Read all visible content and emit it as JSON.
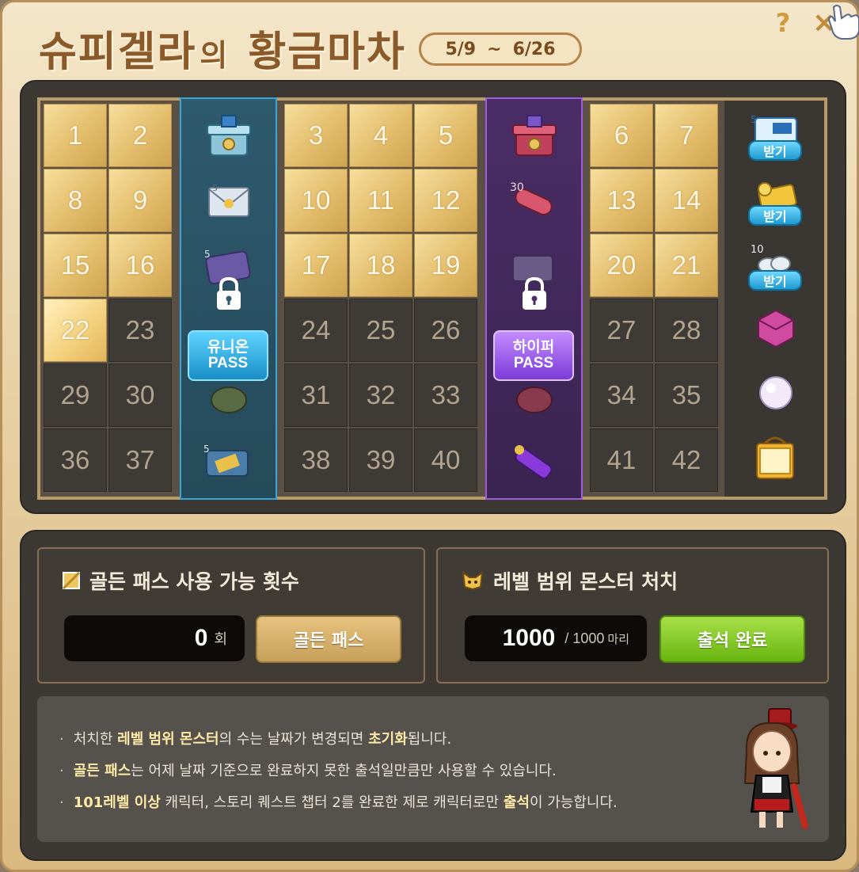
{
  "header": {
    "title_main": "슈피겔라",
    "title_particle": "의",
    "title_sub": "황금마차",
    "date_start": "5/9",
    "date_sep": "~",
    "date_end": "6/26",
    "help": "?",
    "close": "×"
  },
  "calendar": {
    "days_left": [
      {
        "n": "1",
        "s": "gold"
      },
      {
        "n": "2",
        "s": "gold"
      },
      {
        "n": "8",
        "s": "gold"
      },
      {
        "n": "9",
        "s": "gold"
      },
      {
        "n": "15",
        "s": "gold"
      },
      {
        "n": "16",
        "s": "gold"
      },
      {
        "n": "22",
        "s": "today"
      },
      {
        "n": "23",
        "s": "dark"
      },
      {
        "n": "29",
        "s": "dark"
      },
      {
        "n": "30",
        "s": "dark"
      },
      {
        "n": "36",
        "s": "dark"
      },
      {
        "n": "37",
        "s": "dark"
      }
    ],
    "days_mid": [
      {
        "n": "3",
        "s": "gold"
      },
      {
        "n": "4",
        "s": "gold"
      },
      {
        "n": "5",
        "s": "gold"
      },
      {
        "n": "10",
        "s": "gold"
      },
      {
        "n": "11",
        "s": "gold"
      },
      {
        "n": "12",
        "s": "gold"
      },
      {
        "n": "17",
        "s": "gold"
      },
      {
        "n": "18",
        "s": "gold"
      },
      {
        "n": "19",
        "s": "gold"
      },
      {
        "n": "24",
        "s": "dark"
      },
      {
        "n": "25",
        "s": "dark"
      },
      {
        "n": "26",
        "s": "dark"
      },
      {
        "n": "31",
        "s": "dark"
      },
      {
        "n": "32",
        "s": "dark"
      },
      {
        "n": "33",
        "s": "dark"
      },
      {
        "n": "38",
        "s": "dark"
      },
      {
        "n": "39",
        "s": "dark"
      },
      {
        "n": "40",
        "s": "dark"
      }
    ],
    "days_right": [
      {
        "n": "6",
        "s": "gold"
      },
      {
        "n": "7",
        "s": "gold"
      },
      {
        "n": "13",
        "s": "gold"
      },
      {
        "n": "14",
        "s": "gold"
      },
      {
        "n": "20",
        "s": "gold"
      },
      {
        "n": "21",
        "s": "gold"
      },
      {
        "n": "27",
        "s": "dark"
      },
      {
        "n": "28",
        "s": "dark"
      },
      {
        "n": "34",
        "s": "dark"
      },
      {
        "n": "35",
        "s": "dark"
      },
      {
        "n": "41",
        "s": "dark"
      },
      {
        "n": "42",
        "s": "dark"
      }
    ],
    "union_pass": {
      "line1": "유니온",
      "line2": "PASS"
    },
    "hyper_pass": {
      "line1": "하이퍼",
      "line2": "PASS"
    },
    "receive_label": "받기"
  },
  "golden_pass": {
    "title": "골든 패스 사용 가능 횟수",
    "count": "0",
    "unit": "회",
    "button": "골든 패스"
  },
  "monster": {
    "title": "레벨 범위 몬스터 처치",
    "current": "1000",
    "total": "/ 1000",
    "unit": "마리",
    "button": "출석 완료"
  },
  "notes": {
    "n1_a": "처치한 ",
    "n1_b": "레벨 범위 몬스터",
    "n1_c": "의 수는 날짜가 변경되면 ",
    "n1_d": "초기화",
    "n1_e": "됩니다.",
    "n2_a": "골든 패스",
    "n2_b": "는 어제 날짜 기준으로 완료하지 못한 출석일만큼만 사용할 수 있습니다.",
    "n3_a": "101레벨 이상",
    "n3_b": " 캐릭터, 스토리 퀘스트 챕터 2를 완료한 제로 캐릭터로만 ",
    "n3_c": "출석",
    "n3_d": "이 가능합니다."
  }
}
